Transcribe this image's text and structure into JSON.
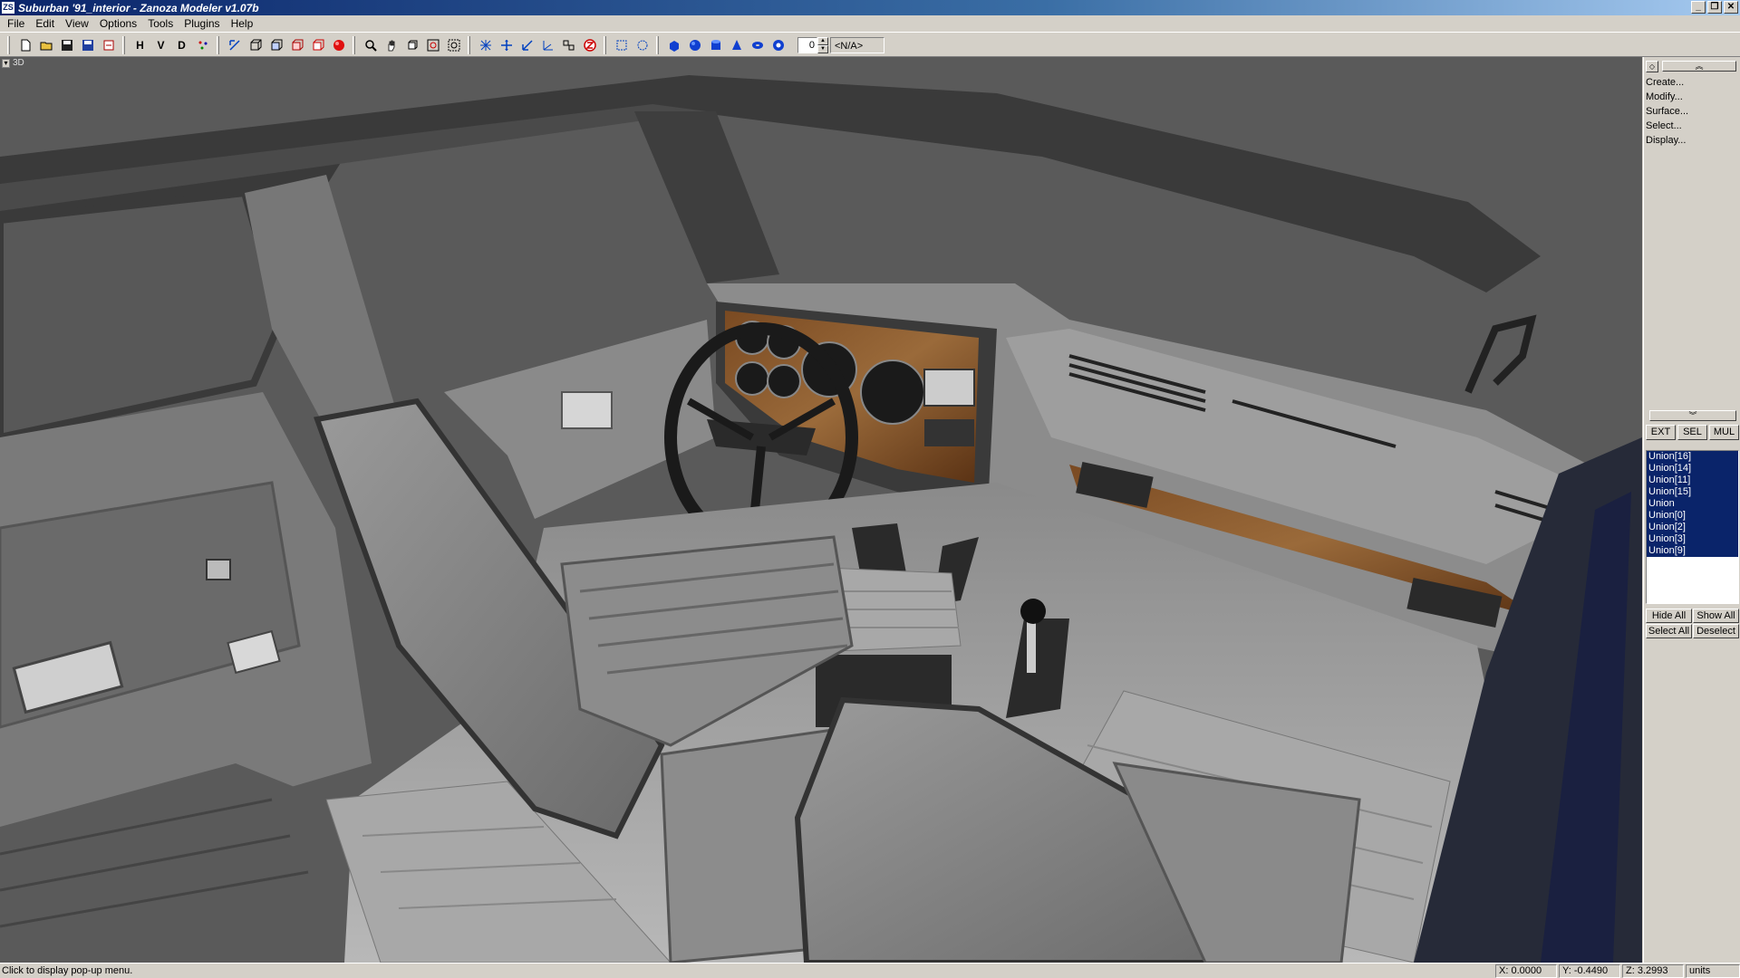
{
  "window": {
    "title": "Suburban '91_interior - Zanoza Modeler v1.07b",
    "icon_text": "ZS",
    "buttons": [
      "minimize-icon",
      "restore-icon",
      "close-icon"
    ]
  },
  "menu": [
    "File",
    "Edit",
    "View",
    "Options",
    "Tools",
    "Plugins",
    "Help"
  ],
  "toolbar": {
    "text_buttons": {
      "h": "H",
      "v": "V",
      "d": "D"
    },
    "spinner_value": "0",
    "combo_value": "<N/A>",
    "colors": {
      "render_red": "#e01010",
      "primitive_blue": "#1040d0"
    }
  },
  "viewport": {
    "label": "3D",
    "background": "#5a5a5a"
  },
  "panel": {
    "commands": [
      "Create...",
      "Modify...",
      "Surface...",
      "Select...",
      "Display..."
    ],
    "modes": [
      "EXT",
      "SEL",
      "MUL"
    ],
    "objects": [
      "Union[16]",
      "Union[14]",
      "Union[11]",
      "Union[15]",
      "Union",
      "Union[0]",
      "Union[2]",
      "Union[3]",
      "Union[9]"
    ],
    "actions": {
      "hide_all": "Hide All",
      "show_all": "Show All",
      "select_all": "Select All",
      "deselect": "Deselect"
    }
  },
  "status": {
    "message": "Click to display pop-up menu.",
    "x": "X: 0.0000",
    "y": "Y: -0.4490",
    "z": "Z: 3.2993",
    "units": "units"
  }
}
